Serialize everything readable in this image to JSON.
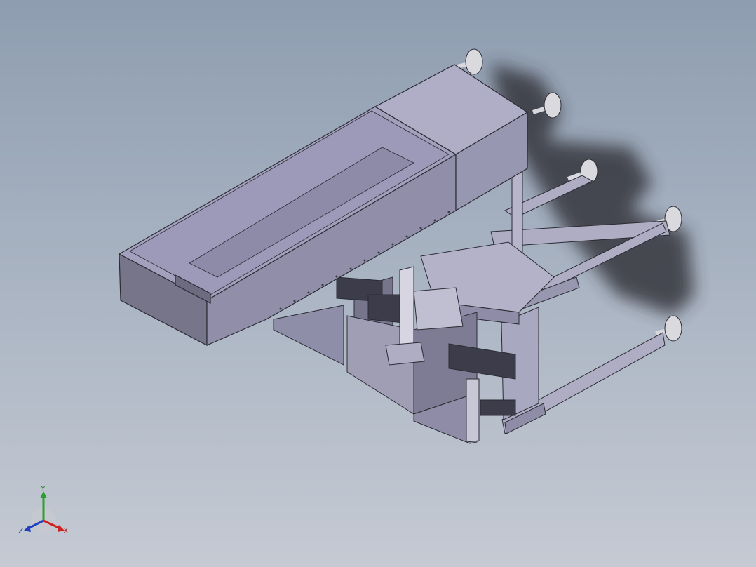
{
  "view": {
    "background_top": "#8e9db0",
    "background_bottom": "#c5cad3",
    "model_color": "#9d9bb7",
    "model_side_color": "#8e8ca6",
    "model_dark_color": "#6f6e82",
    "edge_color": "#2b2b34",
    "shadow_color": "#3a3a40"
  },
  "triad": {
    "x_label": "X",
    "y_label": "Y",
    "z_label": "Z",
    "x_color": "#d02020",
    "y_color": "#2ca02c",
    "z_color": "#2040c0"
  }
}
